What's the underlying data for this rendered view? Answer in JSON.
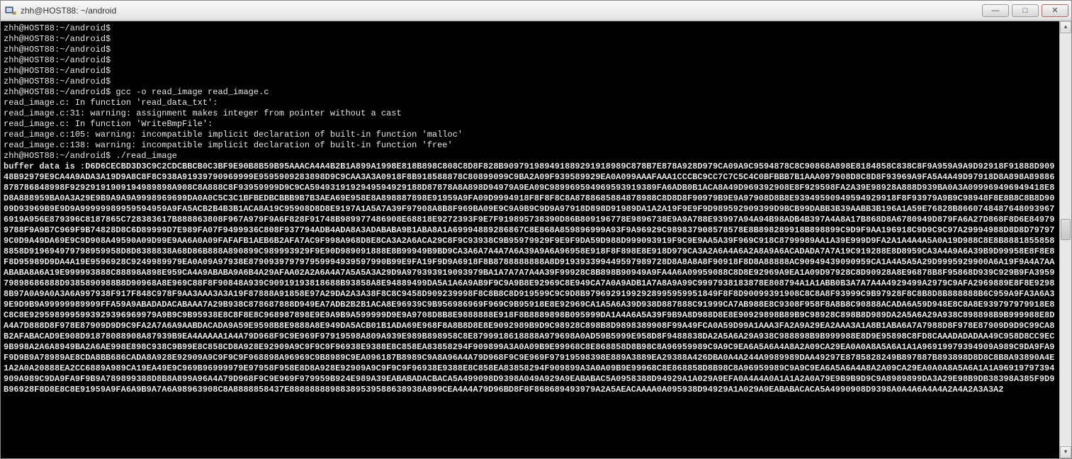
{
  "window": {
    "title": "zhh@HOST88: ~/android",
    "icon_name": "putty-icon"
  },
  "win_buttons": {
    "minimize": "―",
    "maximize": "□",
    "close": "✕"
  },
  "terminal": {
    "prompt": "zhh@HOST88:~/android$",
    "blank_prompts_count": 6,
    "compile_cmd": "gcc -o read_image read_image.c",
    "compiler_output": [
      "read_image.c: In function 'read_data_txt':",
      "read_image.c:31: warning: assignment makes integer from pointer without a cast",
      "read_image.c: In function 'WriteBmpFile':",
      "read_image.c:105: warning: incompatible implicit declaration of built-in function 'malloc'",
      "read_image.c:138: warning: incompatible implicit declaration of built-in function 'free'"
    ],
    "run_cmd": "./read_image",
    "buffer_prefix": "buffer data is :",
    "buffer_hex": "D6D6CECBD3D3C9C2CDCBBCB0C3BF9E90B8B59B95AAACA4A4B2B1A899A1998E818B898C808C8D8F828B909791989491889291918989C878B7E878A928D979CA09A9C9594878C8C90868A898E8184858C838C8F9A959A9A9D92918F91888D90948B92979E9CA4A9ADA3A19D9A8C8F8C938A91939790969999E9595909283898D9C9CAA3A3A0918F8B918588878C80899099C9BA2A09F939589929EA0A099AAAFAAA1CCCBC9CC7C7C5C4C0BFBBB7B1AAA097908D8C8D8F93969A9FA5A4A49D97918D8A898A89886878786848998F92929191909194989898A908C8A888C8F93959999D9C9CA5949319192949594929188D87878A8A898D94979A9EA09C989969594969593919389FA6ADB0B1ACA8A49D969392908E8F929598FA2A39E98928A888D939BA0A3A099969496949418E8D8A888959BA0A3A29E9B9A9A9A9998969699DA0A0C5C3C1BFBEDBCBBB9B7B3AEA69E958E8A898887898E91959A9FA09D9994918F8F8F8C8A8788685884878988C8D8D8F90979B9E9A97908D8B8E93949590949594929918F8F93979A9B9C98948F8E8B8C8B8D9009D93969B9E9D9A99999989959594959A9FA5ACB2B4B3B1ACA8A19C95908D8D8E9197A1A5A7A39F97908A8B8F969BA09E9C9A9B9C9D9A97918D898D91989DA1A2A19F9E9F9D989592909399D9BCB99DABB3B39AABB3B196A1A59E76828B86607484876480939676919A956E879396C8187865C728383617B888863808F967A979F9A6F828F91748B989977486908E68818E9272393F9E7F919895738390D86B809196778E9896738E9A9A788E93997A94A94B98ADB4B397A4A8A17B868D8A6780949D879FA6A27D868F8D6E849799788F9A9B7C969F9B74828D8C6D89999D7E989FA07F9499936C808F937794ADB4ADA8A3ADABABA9B1ABA8A1A69994889286867C8E868A859896999A93F9A96929C989837908578578E8B898289918B898899C9D9F9AA196918C9D9C9C97A29994988D8D8D797979C0D9A49DA69E9C9D908A49590A09D99E9AA6A0A09FAFAFB1AEB6B2AFA7AC9F998A968D8E8CA3A2A6ACA29C8F9C93938C9B95979929F9E9F9DA59D988D999093919F9C9E9AA5A39F969C918C8799989AA1A39E999D9FA2A1A4A4A5A0A19D988C8E8B88818558588858D919694979798959958D8D8388838A68D86B888A890899C989993929F9E90D989091888E8B99949B9BD9CA3A6A7A4A7A6A39A9A6A96958E918F8F898E8E918D979CA3A2A6A4A6A2A8A9A6ACADADA7A7A19C919288E8D8959CA3A4A9A6A39B9D99958E8F8E8F8D95989D9DA4A19E9596928C9249989979EA0A09A97938E879093979797959994939597990B99E9FA19F9D9A6918F8B8788888888A8D919393399449597989728D8A8A8A8F90918F8D8A88888AC90949439090959CA1A4A5A5A29D9995929900A6A19F9A4A7AAABABA8A6A19E999993888C88898A898E959CA4A9ABABA9A6B4A29AFAA02A2A6A4A7A5A5A3A29D9A979393919093979BA1A7A7A7A4A39F99928C8B898B90949A9FA4A6A09959088C8D8E92969A9EA1A09D97928C8D90928A8E96878B8F95868D939C929B9FA395979898686888D9385890988B8D90968A8E969C88F8F90848A939C90919193818688B93858A8E94889499DA5A1A6A9AB9F9C9A9B8E92969C8E949CA7A0A9ADB1A7A8A9A99C9997938183878E808794A1A1ABB0B3A7A7A4A4929499A2979C9AFA2969889E8F8E92988B97A0A9A0A3A6A997938F917F848C978F9AA3AAA3A3A19F87888A91858E97A29DA2A3A38F8C8C9458D909239998F8C8B8C8D919599C9C9D8B97969291992928995959951849F8F8D90099391908C8C8A8F93999C9B97928F8C8B8D8B888888B6C959A9FA3A6A39E9D9B9A99999989999FFA59A9ABADADACABAAA7A29B938C878687888D949EA7ADB2B2B1ACA8E96939C9B956986969F969C9B95918E8E92969CA1A5A6A39D938D887888C91999CA7AB988E8C9308F958F8A8B8C90888ACADA6A59D948E8C8A8E939797979918E8C8C8E9295989995993929396969979A9B9C9B95938E8C8F8E8C968987898E9E9A9B9A599999D9E9A9708D8B8E9888888E918F8B8889898B095999DA1A4A6A5A39F9B9A8D988D8E8E90929898B89B9C98928C898B8D989DA2A5A6A29A938C898898B9B999988E8DA4A7D888D8F978E87909D9D9C9FA2A7A6A9AABDACADA9A59E9598B8E9888A8E949DA5ACB01B1ADA69E968F8A8B8D8E8E9092989B9D9C98928C898B8D9898389908F99A49FCA0A59D99A1AAA3FA2A9A29EA2AAA3A1A8B1ABA6A7A7988D8F978E87909D9D9C99CA8B2AFABACAD9E908D91878088908A87939B9EA4AAAAA1A4A79D968F9C9E969F97919598A809A939E989B898958C8E8799918618888A979698A0AD59B5999E958D8F9488838DA2A5A6A29A938C988898B9B999988E8D9E95898C8FD8CAAADADADAA49C958D8CC9EC9B998A2A6A8949BA2A6AE998E898C938C9B99E8C858CD8A928E92909A9C9F9C9F96938E9388E8C858EA83858294F909899A3A0A09B9E99968C8E868858D8B98C8A96959989C9A9C9EA6A5A6A4A8A2A09CA29EA0A0A8A5A6A1A1A96919979394909A989C9DA9FA9F9D9B9A78989AE8CDA8BB686CADA8A928E92909A9C9F9C9F968898A96969C9B8989C9EA096187B8989C9A8A96A4A79D968F9C9E969F97919598398E889A3889EA29388A426DBA0A4A244A9989989DAA49297E8785828249B897887B893898D8D8C8B8A93890A4E1A2A0A20888EA2CC6889A989CA19EA49E9C969B96999979E97958F958E8D8A928E92909A9C9F9C9F96938E9388E8C858EA83858294F909899A3A0A09B9E99968C8E868858D8B98C8A96959989C9A9C9EA6A5A6A4A8A2A09CA29EA0A0A8A5A6A1A1A96919797394909A989C9DA9FA9F9B9A789899388D8B8A899A96A4A79D968F9C9E969F979959B924E989A39EABABADACBACA5A499098D9398A049A929A9EABABAC5A0958388D94929A1A029A9EFA0A4A4A0A1A1A2A0A79E9B9B9D9C9A8989899DA3A29E98B9DB38398A385F9D9B96928F8D8E8C8E91959A9FA6A9B9A7A6A98963908C8A8888858437E88888888988389539588638938A899CEA4A4A79D96BD8F8F868689493979A2A5AEACAAAA0A095938D94929A1A029A9EABABACACA5A4990908D9398A0A4A6A4A4A2A4A2A3A3A2"
  },
  "scrollbar": {
    "up": "▲",
    "down": "▼"
  }
}
